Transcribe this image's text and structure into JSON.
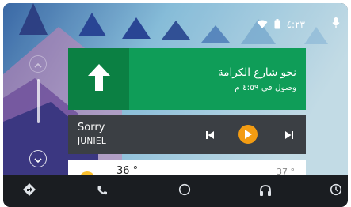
{
  "status": {
    "time": "٤:٢٣"
  },
  "navigation": {
    "street": "نحو شارع الكرامة",
    "eta": "وصول في ٤:٥٩ م"
  },
  "media": {
    "song": "Sorry",
    "artist": "JUNIEL"
  },
  "weather": {
    "high": "36 °",
    "low": "37 °"
  },
  "colors": {
    "nav_card": "#0f9d58",
    "nav_arrow_box": "#0b8043",
    "media_card": "#3b3f44",
    "play_accent": "#f39c12",
    "bottom_bar": "#1a1d21"
  },
  "icons": {
    "status": [
      "wifi-icon",
      "battery-icon",
      "microphone-icon"
    ],
    "rail": [
      "chevron-up-icon",
      "chevron-down-icon"
    ],
    "nav": "straight-arrow-icon",
    "media": [
      "skip-previous-icon",
      "play-icon",
      "skip-next-icon"
    ],
    "weather": "sun-icon",
    "bottom": [
      "navigation-icon",
      "phone-icon",
      "home-icon",
      "headphones-icon",
      "overview-icon"
    ]
  }
}
